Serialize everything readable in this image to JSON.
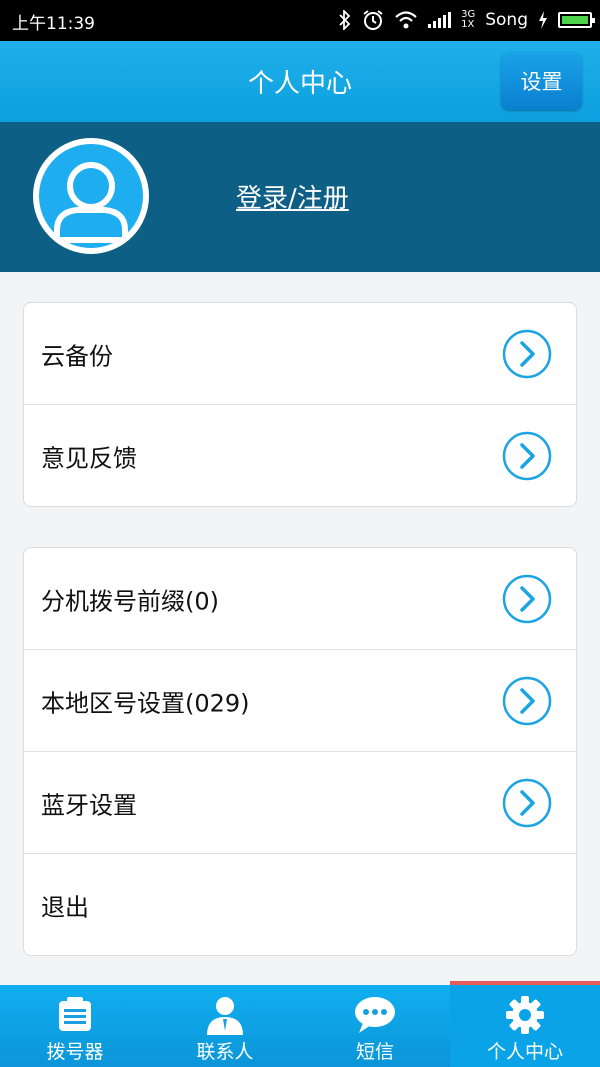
{
  "status_bar": {
    "time": "上午11:39",
    "network_top": "3G",
    "network_bottom": "1X",
    "carrier": "Song"
  },
  "header": {
    "title": "个人中心",
    "settings_label": "设置"
  },
  "profile": {
    "login_label": "登录/注册"
  },
  "group1": [
    {
      "label": "云备份"
    },
    {
      "label": "意见反馈"
    }
  ],
  "group2": [
    {
      "label": "分机拨号前缀(0)"
    },
    {
      "label": "本地区号设置(029)"
    },
    {
      "label": "蓝牙设置"
    },
    {
      "label": "退出"
    }
  ],
  "tabs": [
    {
      "label": "拨号器",
      "icon": "dialpad-icon"
    },
    {
      "label": "联系人",
      "icon": "contact-icon"
    },
    {
      "label": "短信",
      "icon": "message-icon"
    },
    {
      "label": "个人中心",
      "icon": "gear-icon",
      "active": true
    }
  ],
  "colors": {
    "accent": "#12a8ea",
    "profile_bg": "#0e5f86",
    "active_indicator": "#e45c5c"
  }
}
